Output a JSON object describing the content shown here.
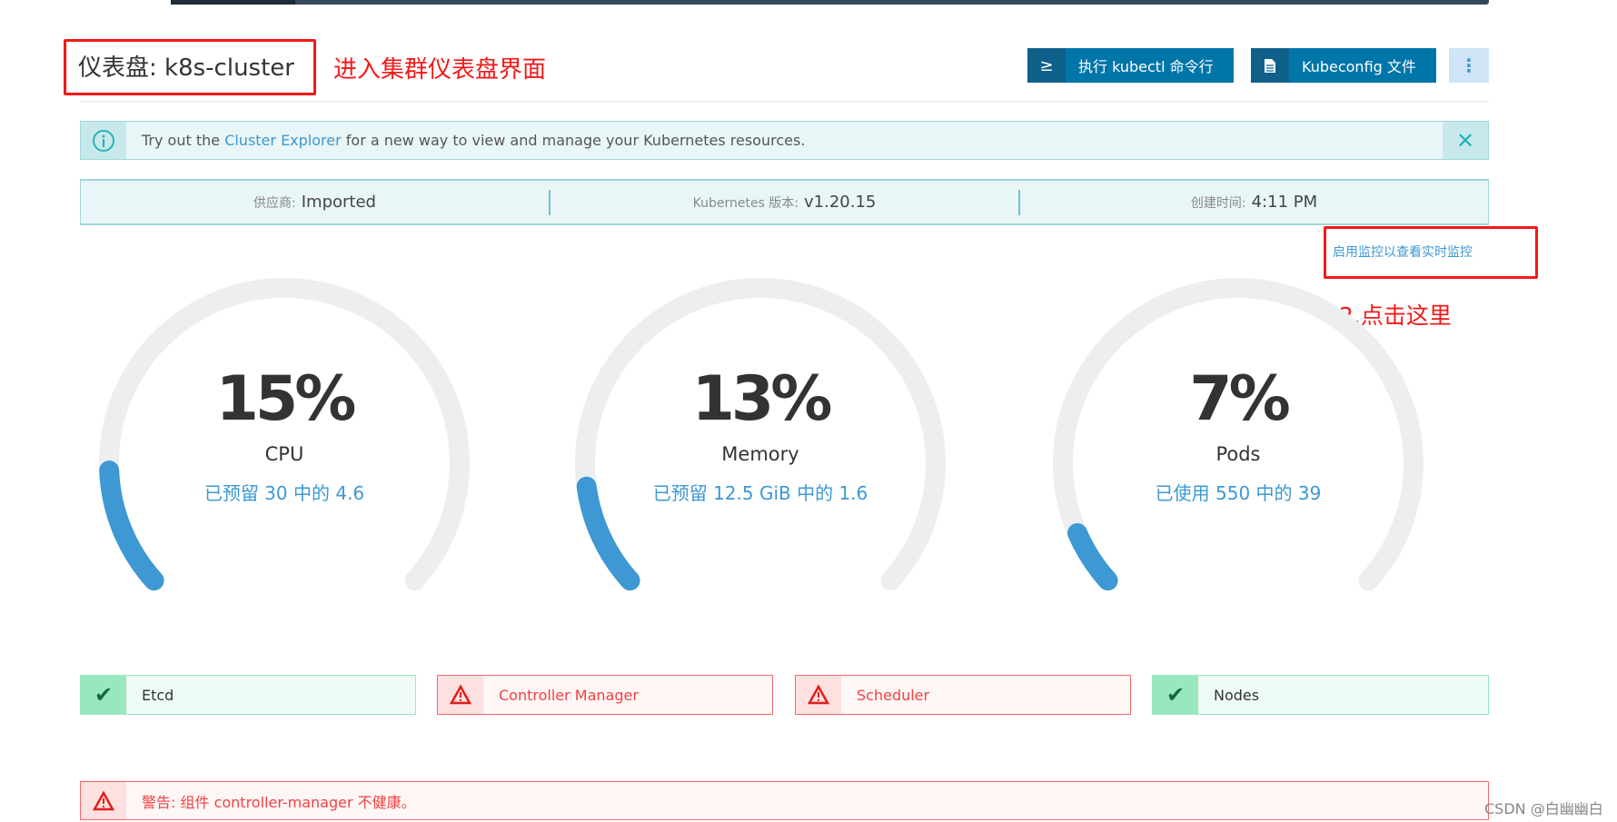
{
  "header": {
    "title": "仪表盘: k8s-cluster",
    "annotation": "进入集群仪表盘界面",
    "kubectl_button": "执行 kubectl 命令行",
    "kubeconfig_button": "Kubeconfig 文件"
  },
  "banner": {
    "prefix": "Try out the ",
    "link": "Cluster Explorer",
    "suffix": " for a new way to view and manage your Kubernetes resources."
  },
  "info": [
    {
      "key": "供应商:",
      "value": "Imported"
    },
    {
      "key": "Kubernetes 版本:",
      "value": "v1.20.15"
    },
    {
      "key": "创建时间:",
      "value": "4:11 PM"
    }
  ],
  "monitoring": {
    "link": "启用监控以查看实时监控",
    "annotation": "2.点击这里"
  },
  "gauges": [
    {
      "percent_label": "15%",
      "percent": 15,
      "name": "CPU",
      "detail": "已预留 30 中的 4.6"
    },
    {
      "percent_label": "13%",
      "percent": 13,
      "name": "Memory",
      "detail": "已预留 12.5 GiB 中的 1.6"
    },
    {
      "percent_label": "7%",
      "percent": 7,
      "name": "Pods",
      "detail": "已使用 550 中的 39"
    }
  ],
  "components": [
    {
      "name": "Etcd",
      "status": "ok"
    },
    {
      "name": "Controller Manager",
      "status": "error"
    },
    {
      "name": "Scheduler",
      "status": "error"
    },
    {
      "name": "Nodes",
      "status": "ok"
    }
  ],
  "warning": "警告: 组件 controller-manager 不健康。",
  "watermark": "CSDN @白幽幽白",
  "colors": {
    "primary": "#0075a8",
    "gauge_fill": "#3d98d3",
    "gauge_track": "#eceeef",
    "error": "#f24141",
    "success": "#98e7bf",
    "annotation": "#f41818"
  }
}
